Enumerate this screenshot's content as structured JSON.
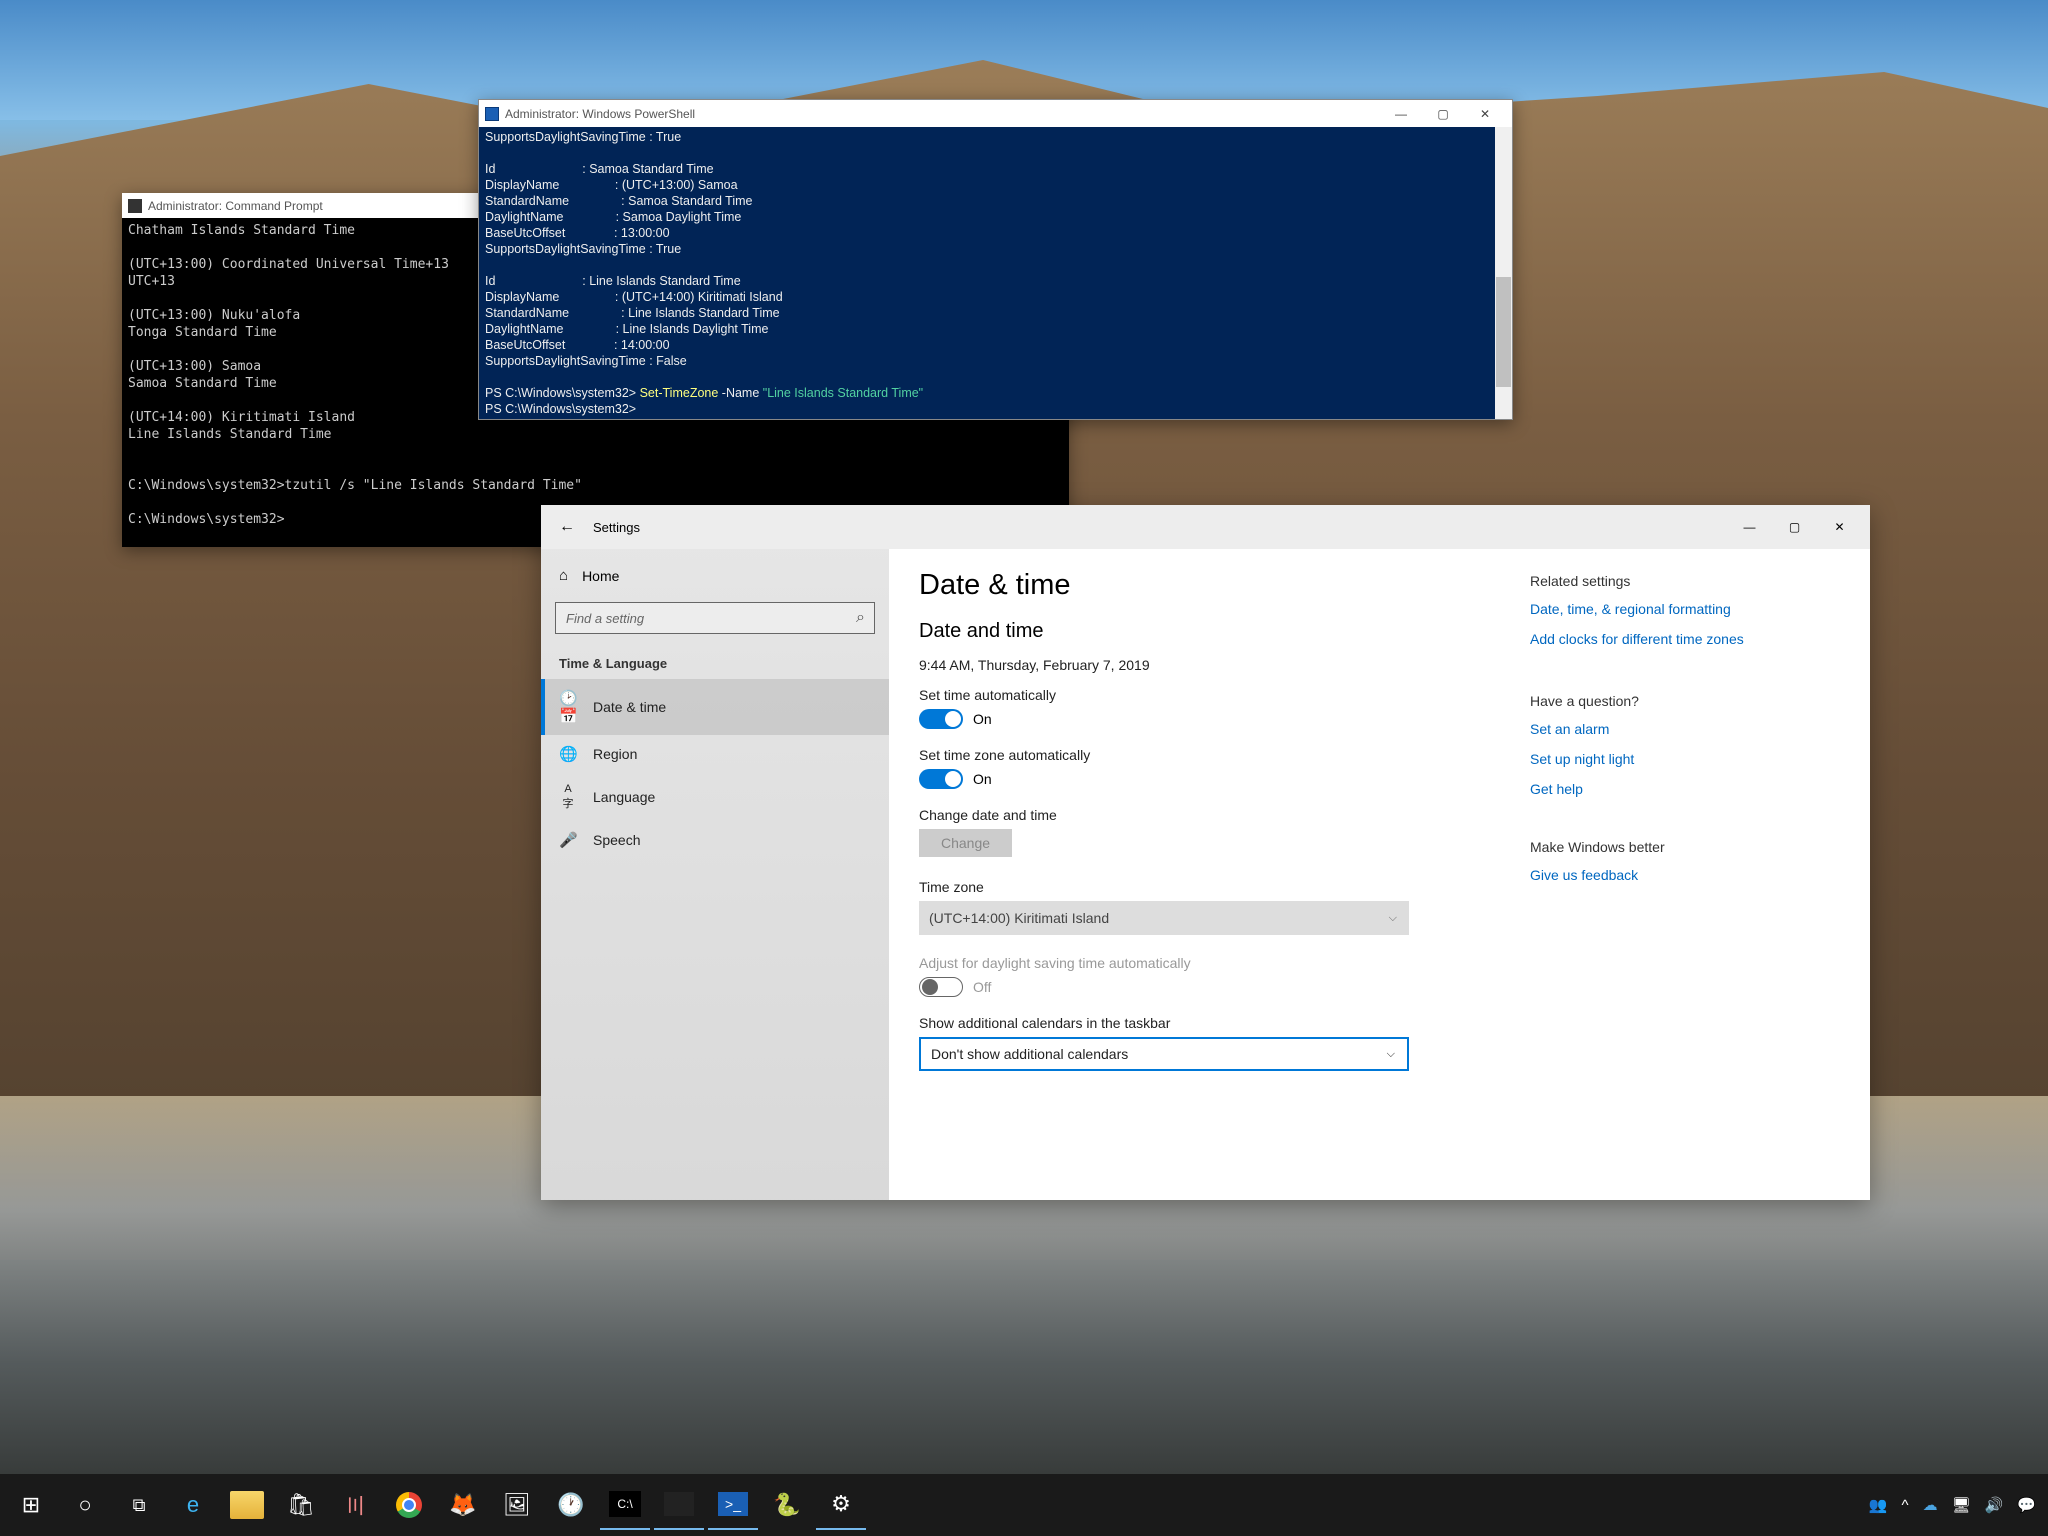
{
  "cmd": {
    "title": "Administrator: Command Prompt",
    "lines": "Chatham Islands Standard Time\n\n(UTC+13:00) Coordinated Universal Time+13\nUTC+13\n\n(UTC+13:00) Nuku'alofa\nTonga Standard Time\n\n(UTC+13:00) Samoa\nSamoa Standard Time\n\n(UTC+14:00) Kiritimati Island\nLine Islands Standard Time\n\n\nC:\\Windows\\system32>tzutil /s \"Line Islands Standard Time\"\n\nC:\\Windows\\system32>"
  },
  "ps": {
    "title": "Administrator: Windows PowerShell",
    "pre": "SupportsDaylightSavingTime : True\n\nId                         : Samoa Standard Time\nDisplayName                : (UTC+13:00) Samoa\nStandardName               : Samoa Standard Time\nDaylightName               : Samoa Daylight Time\nBaseUtcOffset              : 13:00:00\nSupportsDaylightSavingTime : True\n\nId                         : Line Islands Standard Time\nDisplayName                : (UTC+14:00) Kiritimati Island\nStandardName               : Line Islands Standard Time\nDaylightName               : Line Islands Daylight Time\nBaseUtcOffset              : 14:00:00\nSupportsDaylightSavingTime : False\n\n",
    "prompt1": "PS C:\\Windows\\system32> ",
    "cmd": "Set-TimeZone",
    "flag": " -Name ",
    "arg": "\"Line Islands Standard Time\"",
    "prompt2": "PS C:\\Windows\\system32> ",
    "min": "—",
    "max": "▢",
    "close": "✕"
  },
  "settings": {
    "title": "Settings",
    "min": "—",
    "max": "▢",
    "close": "✕",
    "nav": {
      "home": "Home",
      "search_ph": "Find a setting",
      "category": "Time & Language",
      "items": [
        {
          "icon": "🕑📅",
          "label": "Date & time"
        },
        {
          "icon": "🌐",
          "label": "Region"
        },
        {
          "icon": "A字",
          "label": "Language"
        },
        {
          "icon": "🎤",
          "label": "Speech"
        }
      ]
    },
    "main": {
      "h1": "Date & time",
      "h2": "Date and time",
      "now": "9:44 AM, Thursday, February 7, 2019",
      "auto_time_lbl": "Set time automatically",
      "on": "On",
      "auto_tz_lbl": "Set time zone automatically",
      "change_lbl": "Change date and time",
      "change_btn": "Change",
      "tz_lbl": "Time zone",
      "tz_val": "(UTC+14:00) Kiritimati Island",
      "dst_lbl": "Adjust for daylight saving time automatically",
      "off": "Off",
      "addcal_lbl": "Show additional calendars in the taskbar",
      "addcal_val": "Don't show additional calendars"
    },
    "side": {
      "related_h": "Related settings",
      "link1": "Date, time, & regional formatting",
      "link2": "Add clocks for different time zones",
      "question_h": "Have a question?",
      "link3": "Set an alarm",
      "link4": "Set up night light",
      "link5": "Get help",
      "better_h": "Make Windows better",
      "link6": "Give us feedback"
    }
  },
  "taskbar": {
    "tray": {
      "people": "👥",
      "up": "^",
      "cloud": "☁",
      "net": "🖥",
      "vol": "🔊",
      "note": "💬"
    }
  }
}
